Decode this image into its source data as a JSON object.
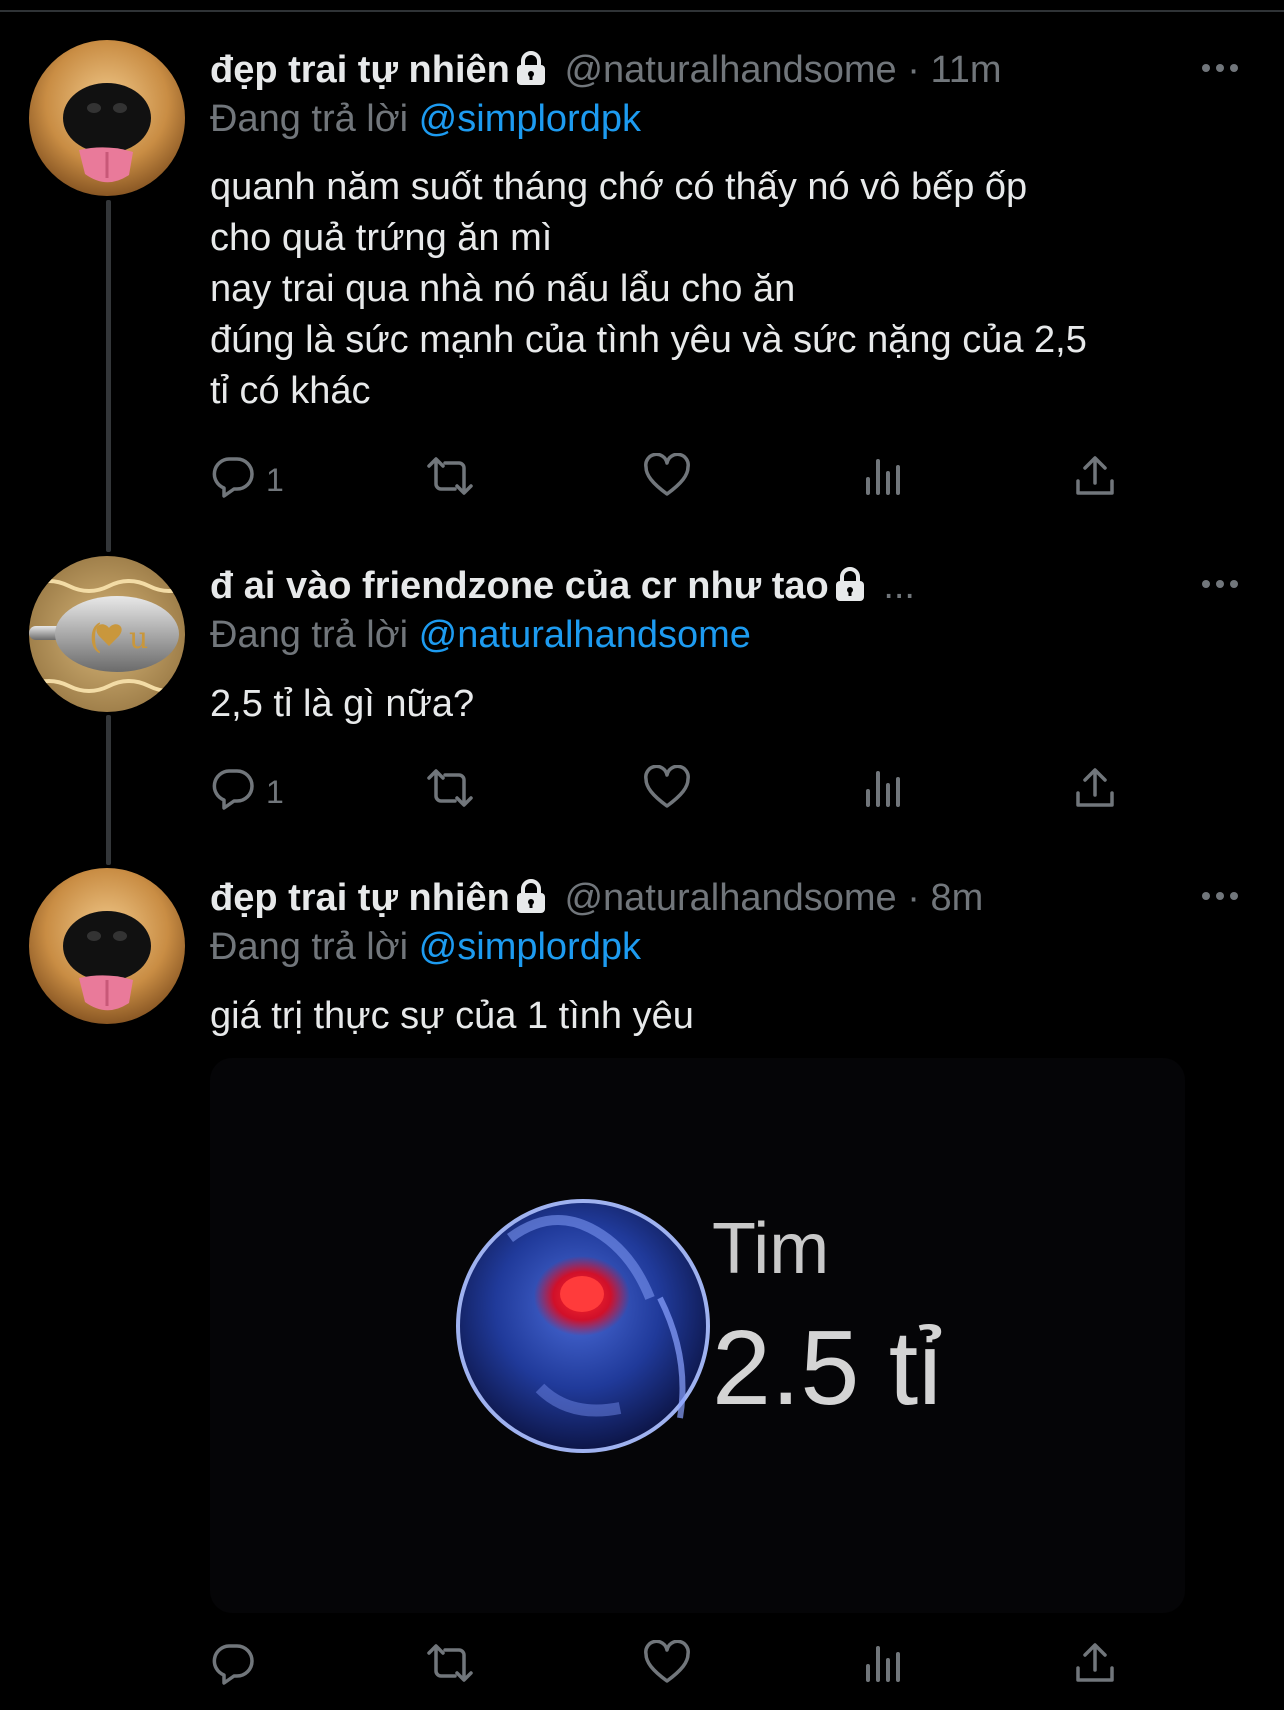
{
  "tweets": [
    {
      "name": "đẹp trai tự nhiên",
      "handle": "@naturalhandsome",
      "separator": "·",
      "time": "11m",
      "reply_prefix": "Đang trả lời",
      "reply_mention": "@simplordpk",
      "lines": [
        "quanh năm suốt tháng chớ có thấy nó vô bếp ốp",
        "cho quả trứng ăn mì",
        "nay trai qua nhà nó nấu lẩu cho ăn",
        "đúng là sức mạnh của tình yêu và sức nặng của 2,5",
        "tỉ có khác"
      ],
      "reply_count": "1"
    },
    {
      "name": "đ ai vào friendzone của cr như tao",
      "truncation": "...",
      "reply_prefix": "Đang trả lời",
      "reply_mention": "@naturalhandsome",
      "lines": [
        "2,5 tỉ là gì nữa?"
      ],
      "reply_count": "1"
    },
    {
      "name": "đẹp trai tự nhiên",
      "handle": "@naturalhandsome",
      "separator": "·",
      "time": "8m",
      "reply_prefix": "Đang trả lời",
      "reply_mention": "@simplordpk",
      "lines": [
        "giá trị thực sự của 1 tình yêu"
      ],
      "media": {
        "label": "Tim",
        "value": "2.5 tỉ"
      }
    }
  ],
  "colors": {
    "background": "#000000",
    "primary_text": "#e7e9ea",
    "secondary_text": "#71767b",
    "mention": "#1d9bf0",
    "thread_line": "#333639"
  },
  "icons": [
    "lock-icon",
    "more-icon",
    "reply-icon",
    "retweet-icon",
    "like-icon",
    "views-icon",
    "share-icon"
  ]
}
